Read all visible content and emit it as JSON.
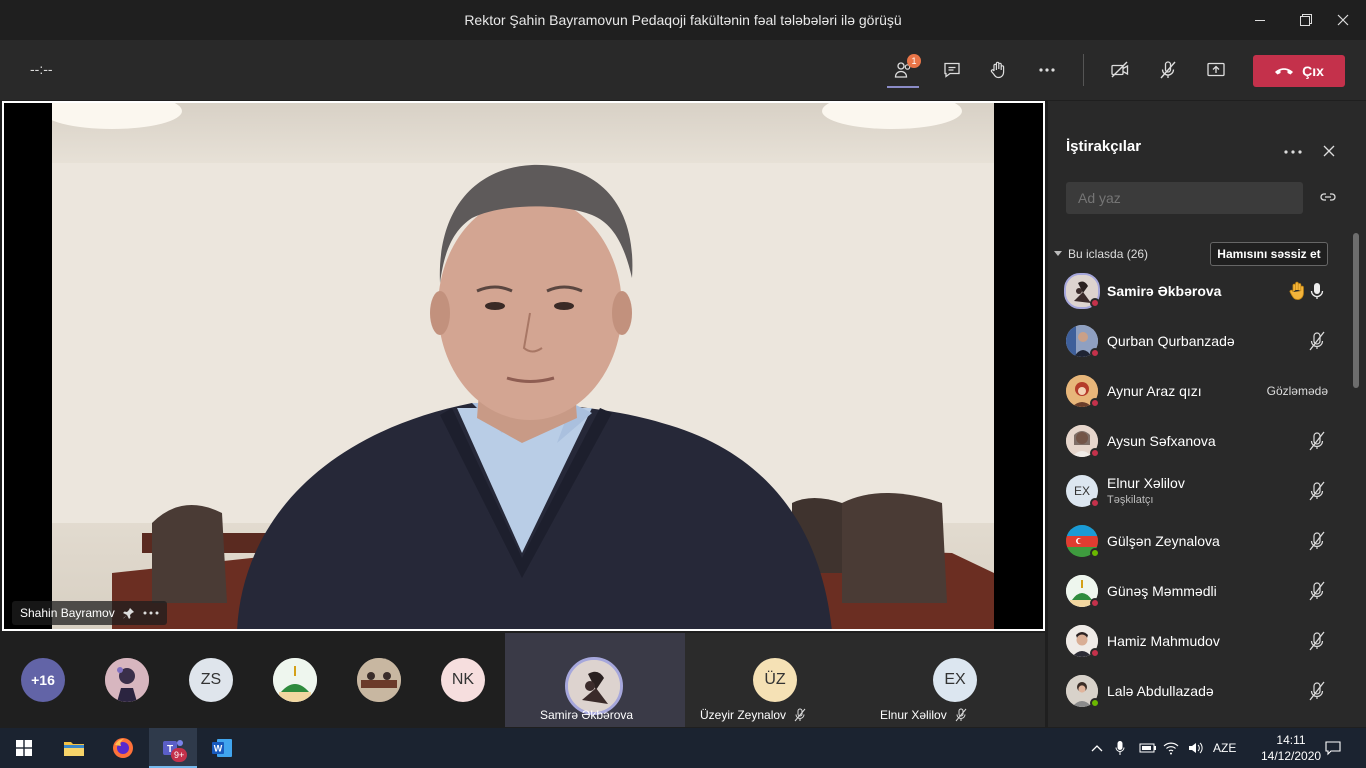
{
  "window": {
    "title": "Rektor Şahin Bayramovun Pedaqoji fakültənin fəal tələbələri ilə görüşü"
  },
  "toolbar": {
    "timer": "--:--",
    "participants_badge": "1",
    "leave_label": "Çıx"
  },
  "stage": {
    "speaker_name": "Shahin Bayramov"
  },
  "strip": {
    "overflow_count": "+16",
    "avatars": [
      {
        "initials": "",
        "kind": "photo"
      },
      {
        "initials": "ZS",
        "kind": "initials"
      },
      {
        "initials": "",
        "kind": "photo"
      },
      {
        "initials": "",
        "kind": "photo"
      },
      {
        "initials": "NK",
        "kind": "initials"
      }
    ],
    "tiles": [
      {
        "name": "Samirə Əkbərova",
        "initials": ""
      },
      {
        "name": "Üzeyir Zeynalov",
        "initials": "ÜZ"
      },
      {
        "name": "Elnur Xəlilov",
        "initials": "EX"
      }
    ]
  },
  "panel": {
    "title": "İştirakçılar",
    "search_placeholder": "Ad yaz",
    "section_label": "Bu iclasda (26)",
    "mute_all_label": "Hamısını səssiz et",
    "participants": [
      {
        "name": "Samirə Əkbərova",
        "role": "",
        "status": "",
        "state": "hand-raised-unmuted"
      },
      {
        "name": "Qurban Qurbanzadə",
        "role": "",
        "status": "",
        "state": "muted"
      },
      {
        "name": "Aynur Araz qızı",
        "role": "",
        "status": "Gözləmədə",
        "state": "on-hold"
      },
      {
        "name": "Aysun Səfxanova",
        "role": "",
        "status": "",
        "state": "muted"
      },
      {
        "name": "Elnur Xəlilov",
        "role": "Təşkilatçı",
        "status": "",
        "state": "muted",
        "initials": "EX"
      },
      {
        "name": "Gülşən Zeynalova",
        "role": "",
        "status": "",
        "state": "muted"
      },
      {
        "name": "Günəş Məmmədli",
        "role": "",
        "status": "",
        "state": "muted"
      },
      {
        "name": "Hamiz Mahmudov",
        "role": "",
        "status": "",
        "state": "muted"
      },
      {
        "name": "Lalə Abdullazadə",
        "role": "",
        "status": "",
        "state": "muted"
      }
    ]
  },
  "taskbar": {
    "teams_badge": "9+",
    "language": "AZE",
    "time": "14:11",
    "date": "14/12/2020"
  },
  "colors": {
    "accent": "#8b8cc7",
    "leave": "#c4314b",
    "busy": "#c4314b",
    "available": "#6bb700"
  }
}
